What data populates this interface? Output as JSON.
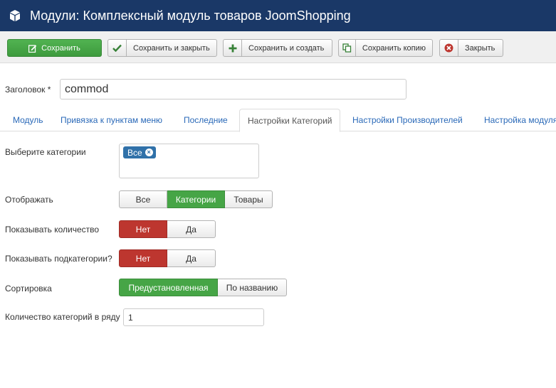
{
  "header": {
    "title": "Модули: Комплексный модуль товаров JoomShopping",
    "icon": "cube-icon"
  },
  "toolbar": {
    "save": "Сохранить",
    "save_close": "Сохранить и закрыть",
    "save_new": "Сохранить и создать",
    "save_copy": "Сохранить копию",
    "close": "Закрыть"
  },
  "title_field": {
    "label": "Заголовок *",
    "value": "commod"
  },
  "tabs": [
    {
      "label": "Модуль"
    },
    {
      "label": "Привязка к пунктам меню"
    },
    {
      "label": "Последние"
    },
    {
      "label": "Настройки Категорий",
      "active": true
    },
    {
      "label": "Настройки Производителей"
    },
    {
      "label": "Настройка модуля"
    }
  ],
  "form": {
    "categories": {
      "label": "Выберите категории",
      "chip": "Все"
    },
    "display": {
      "label": "Отображать",
      "options": [
        "Все",
        "Категории",
        "Товары"
      ],
      "selected": "Категории"
    },
    "show_count": {
      "label": "Показывать количество",
      "options": [
        "Нет",
        "Да"
      ],
      "selected": "Нет"
    },
    "show_subcats": {
      "label": "Показывать подкатегории?",
      "options": [
        "Нет",
        "Да"
      ],
      "selected": "Нет"
    },
    "sort": {
      "label": "Сортировка",
      "options": [
        "Предустановленная",
        "По названию"
      ],
      "selected": "Предустановленная"
    },
    "per_row": {
      "label": "Количество категорий в ряду",
      "value": "1"
    }
  },
  "colors": {
    "header_bg": "#1a3867",
    "success": "#46a546",
    "danger": "#bd362f",
    "link": "#2a69b8",
    "chip": "#3071a9"
  }
}
